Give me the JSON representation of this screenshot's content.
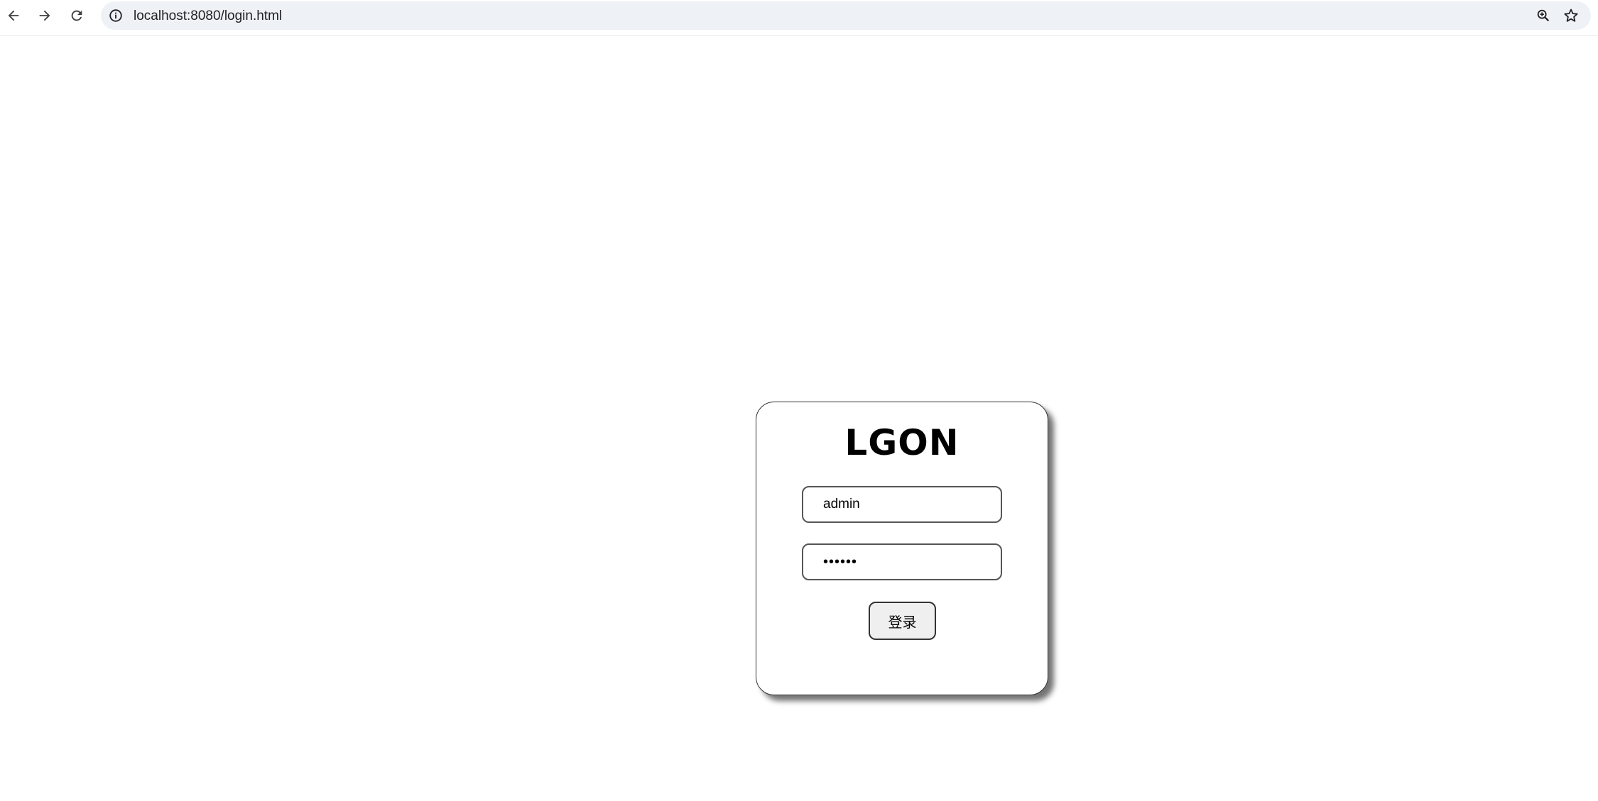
{
  "browser": {
    "url": "localhost:8080/login.html",
    "icons": {
      "back": "arrow-left-icon",
      "forward": "arrow-right-icon",
      "reload": "reload-icon",
      "site_info": "info-icon",
      "zoom": "zoom-icon",
      "bookmark": "star-icon"
    }
  },
  "login": {
    "title": "LGON",
    "username_value": "admin",
    "password_value": "••••••",
    "submit_label": "登录"
  }
}
